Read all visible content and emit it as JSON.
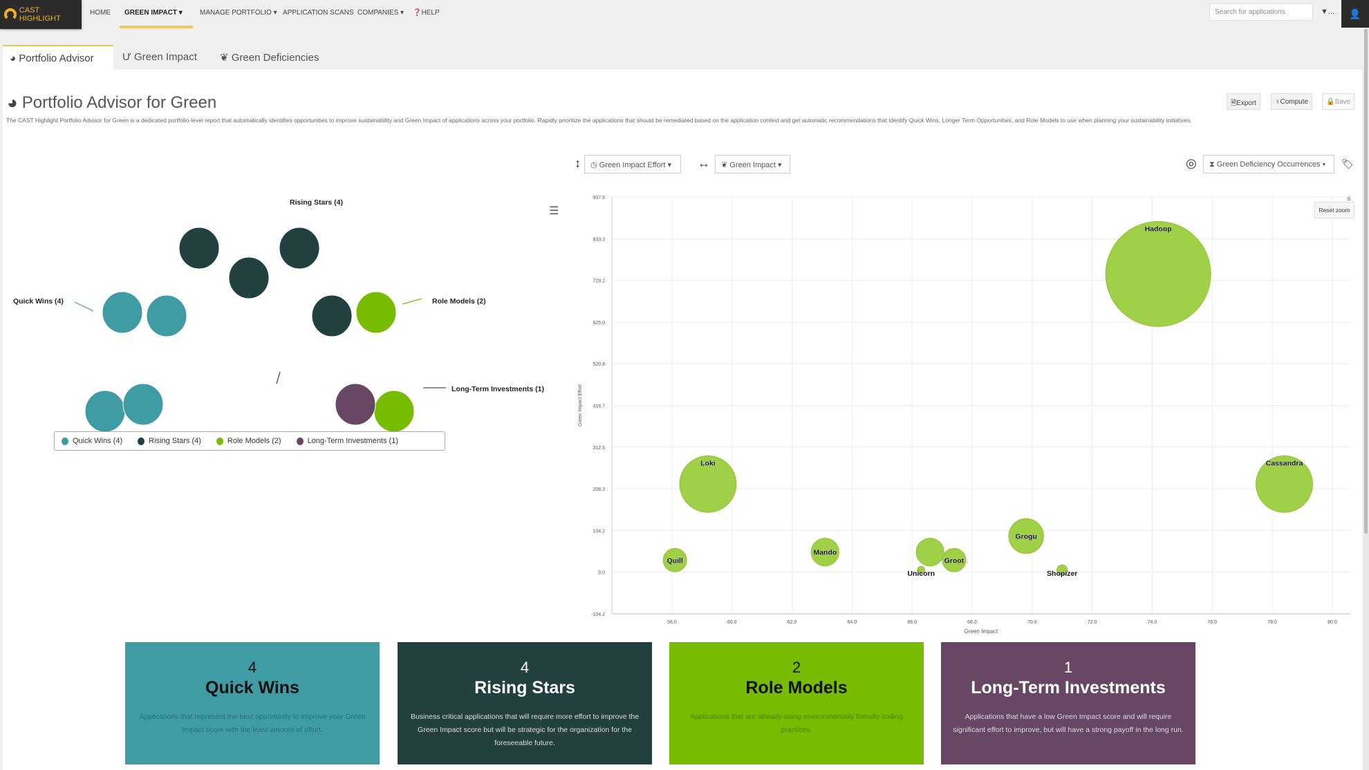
{
  "topnav": {
    "logo": "CAST HIGHLIGHT",
    "items": [
      "HOME",
      "GREEN IMPACT ▾",
      "MANAGE PORTFOLIO ▾",
      "APPLICATION SCANS",
      "COMPANIES ▾",
      "HELP"
    ],
    "search_placeholder": "Search for applications",
    "filter": "▼...",
    "user_icon": "user-icon"
  },
  "tabs": [
    {
      "label": "Portfolio Advisor",
      "icon": "pie-chart-icon",
      "active": true
    },
    {
      "label": "Green Impact",
      "icon": "stethoscope-icon"
    },
    {
      "label": "Green Deficiencies",
      "icon": "leaf-icon"
    }
  ],
  "page": {
    "title": "Portfolio Advisor for Green",
    "description": "The CAST Highlight Portfolio Advisor for Green is a dedicated portfolio-level report that automatically identifies opportunities to improve sustainability and Green Impact of applications across your portfolio. Rapidly prioritize the applications that should be remediated based on the application context and get automatic recommendations that identify Quick Wins, Longer Term Opportunities, and Role Models to use when planning your sustainability initiatives.",
    "buttons": {
      "export": "Export",
      "compute": "Compute",
      "save": "Save"
    }
  },
  "controls": {
    "y_axis": "Green Impact Effort ▾",
    "x_axis": "Green Impact ▾",
    "size": "Green Deficiency Occurrences ▾",
    "reset_zoom": "Reset zoom"
  },
  "colors": {
    "quick_wins": "#3f9ca4",
    "rising_stars": "#22403f",
    "role_models": "#77bc00",
    "long_term": "#674763",
    "bubble": "#9bcd3d",
    "accent": "#f7c35c"
  },
  "chart_data": [
    {
      "type": "packed-bubble",
      "series": [
        {
          "name": "Quick Wins (4)",
          "count": 4,
          "color": "#3f9ca4"
        },
        {
          "name": "Rising Stars (4)",
          "count": 4,
          "color": "#22403f"
        },
        {
          "name": "Role Models (2)",
          "count": 2,
          "color": "#77bc00"
        },
        {
          "name": "Long-Term Investments (1)",
          "count": 1,
          "color": "#674763"
        }
      ],
      "legend": "bottom"
    },
    {
      "type": "bubble",
      "xlabel": "Green Impact",
      "ylabel": "Green Impact Effort",
      "size_label": "Green Deficiency Occurrences",
      "xlim": [
        56,
        80.6
      ],
      "ylim": [
        -104.2,
        937.5
      ],
      "xticks": [
        "58.0",
        "60.0",
        "62.0",
        "64.0",
        "66.0",
        "68.0",
        "70.0",
        "72.0",
        "74.0",
        "76.0",
        "78.0",
        "80.0"
      ],
      "yticks": [
        "-104.2",
        "0.0",
        "104.2",
        "208.3",
        "312.5",
        "416.7",
        "520.8",
        "625.0",
        "729.2",
        "833.3",
        "937.5"
      ],
      "grid": true,
      "points": [
        {
          "name": "Hadoop",
          "x": 74.2,
          "y": 745,
          "z": 100
        },
        {
          "name": "Loki",
          "x": 59.2,
          "y": 220,
          "z": 29
        },
        {
          "name": "Cassandra",
          "x": 78.4,
          "y": 220,
          "z": 29
        },
        {
          "name": "Quill",
          "x": 58.1,
          "y": 30,
          "z": 5
        },
        {
          "name": "Mando",
          "x": 63.1,
          "y": 50,
          "z": 7
        },
        {
          "name": "",
          "x": 66.6,
          "y": 50,
          "z": 7
        },
        {
          "name": "Groot",
          "x": 67.4,
          "y": 30,
          "z": 5
        },
        {
          "name": "Unicorn",
          "x": 66.3,
          "y": 5,
          "z": 0.5
        },
        {
          "name": "Grogu",
          "x": 69.8,
          "y": 90,
          "z": 11
        },
        {
          "name": "Shopizer",
          "x": 71.0,
          "y": 5,
          "z": 1
        }
      ]
    }
  ],
  "cards": [
    {
      "count": "4",
      "title": "Quick Wins",
      "desc": "Applications that represent the best opportunity to improve your Green Impact score with the least amount of effort."
    },
    {
      "count": "4",
      "title": "Rising Stars",
      "desc": "Business critical applications that will require more effort to improve the Green Impact score but will be strategic for the organization for the foreseeable future."
    },
    {
      "count": "2",
      "title": "Role Models",
      "desc": "Applications that are already using environmentally friendly coding practices."
    },
    {
      "count": "1",
      "title": "Long-Term Investments",
      "desc": "Applications that have a low Green Impact score and will require significant effort to improve, but will have a strong payoff in the long run."
    }
  ]
}
